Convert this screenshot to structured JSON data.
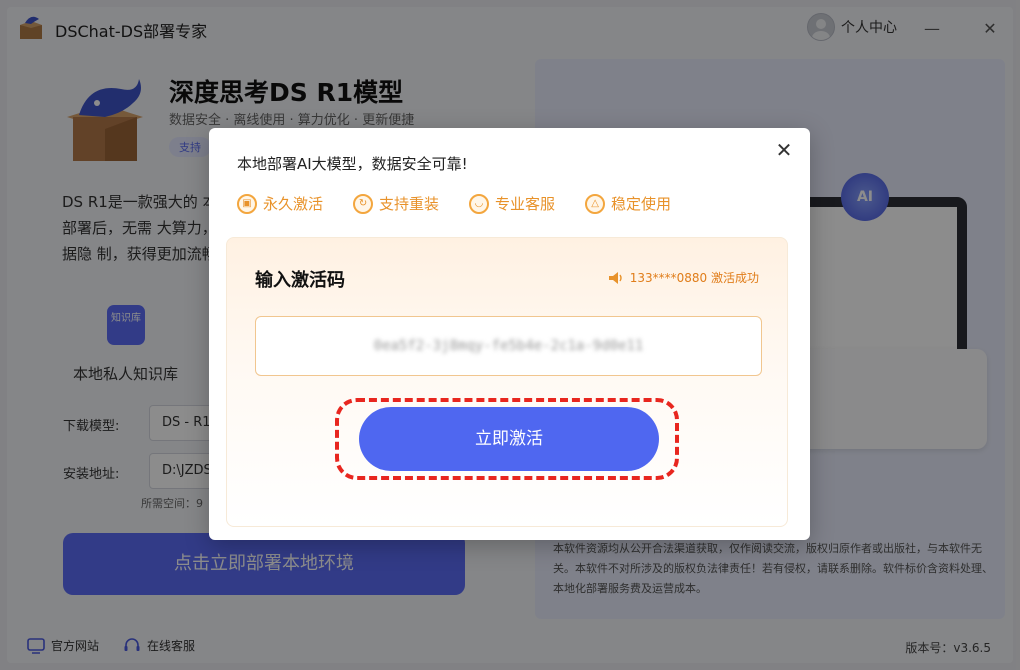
{
  "window": {
    "title": "DSChat-DS部署专家"
  },
  "header": {
    "user_center": "个人中心",
    "minimize": "—",
    "close": "✕"
  },
  "main": {
    "title": "深度思考DS R1模型",
    "subtitle": "数据安全 · 离线使用 · 算力优化 · 更新便捷",
    "tag": "支持",
    "description": "DS R1是一款强大的 本地化部署后，无需 大算力，获得数据隐 制，获得更加流畅、",
    "knowledge_icon": "知识库",
    "knowledge_label": "本地私人知识库",
    "download_model_label": "下载模型:",
    "download_model_value": "DS - R1",
    "install_path_label": "安装地址:",
    "install_path_value": "D:\\JZDS",
    "space_required": "所需空间：9",
    "deploy_button": "点击立即部署本地环境",
    "disclaimer": "本软件资源均从公开合法渠道获取，仅作阅读交流，版权归原作者或出版社，与本软件无关。本软件不对所涉及的版权负法律责任！若有侵权，请联系删除。软件标价含资料处理、本地化部署服务费及运营成本。"
  },
  "footer": {
    "official_site": "官方网站",
    "online_service": "在线客服",
    "version": "版本号：v3.6.5"
  },
  "modal": {
    "close": "✕",
    "headline": "本地部署AI大模型，数据安全可靠!",
    "features": [
      {
        "label": "永久激活",
        "icon": "permanent-icon"
      },
      {
        "label": "支持重装",
        "icon": "reinstall-icon"
      },
      {
        "label": "专业客服",
        "icon": "headset-icon"
      },
      {
        "label": "稳定使用",
        "icon": "stable-icon"
      }
    ],
    "input_title": "输入激活码",
    "notice": "133****0880 激活成功",
    "code_value": "0ea5f2-3j8mqy-fe5b4e-2c1a-9d0e11",
    "activate_button": "立即激活"
  }
}
